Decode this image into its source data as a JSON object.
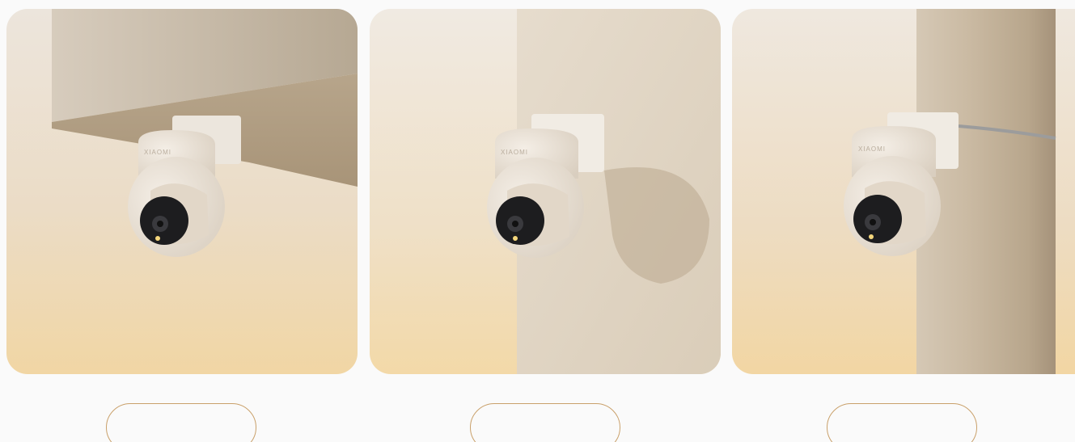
{
  "gallery": {
    "images": [
      {
        "subject": "camera-under-ceiling"
      },
      {
        "subject": "camera-on-wall"
      },
      {
        "subject": "camera-on-pole"
      }
    ],
    "camera_brand": "Xiaomi",
    "buttons": [
      {
        "label": ""
      },
      {
        "label": ""
      },
      {
        "label": ""
      }
    ]
  },
  "colors": {
    "page_bg": "#fafafa",
    "button_border": "#c9a06a",
    "warm_light": "#f2d8a6",
    "camera_body": "#ede4d8"
  }
}
